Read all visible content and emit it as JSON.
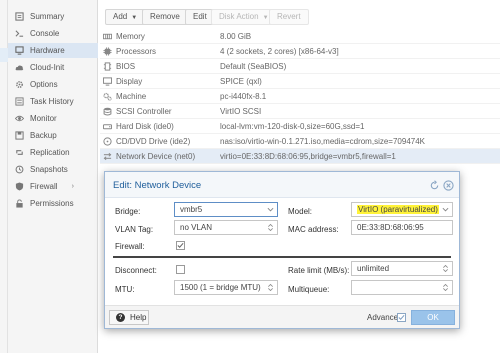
{
  "sidebar": {
    "items": [
      {
        "label": "Summary",
        "icon": "summary-icon"
      },
      {
        "label": "Console",
        "icon": "console-icon"
      },
      {
        "label": "Hardware",
        "icon": "desktop-icon",
        "active": true
      },
      {
        "label": "Cloud-Init",
        "icon": "cloud-icon"
      },
      {
        "label": "Options",
        "icon": "gear-icon"
      },
      {
        "label": "Task History",
        "icon": "list-icon"
      },
      {
        "label": "Monitor",
        "icon": "eye-icon"
      },
      {
        "label": "Backup",
        "icon": "floppy-icon"
      },
      {
        "label": "Replication",
        "icon": "retweet-icon"
      },
      {
        "label": "Snapshots",
        "icon": "history-icon"
      },
      {
        "label": "Firewall",
        "icon": "shield-icon"
      },
      {
        "label": "Permissions",
        "icon": "unlock-icon"
      }
    ]
  },
  "toolbar": {
    "add": "Add",
    "remove": "Remove",
    "edit": "Edit",
    "disk_action": "Disk Action",
    "revert": "Revert"
  },
  "hardware": [
    {
      "key": "Memory",
      "value": "8.00 GiB",
      "icon": "memory-icon"
    },
    {
      "key": "Processors",
      "value": "4 (2 sockets, 2 cores) [x86-64-v3]",
      "icon": "cpu-icon"
    },
    {
      "key": "BIOS",
      "value": "Default (SeaBIOS)",
      "icon": "microchip-icon"
    },
    {
      "key": "Display",
      "value": "SPICE (qxl)",
      "icon": "monitor-icon"
    },
    {
      "key": "Machine",
      "value": "pc-i440fx-8.1",
      "icon": "cogs-icon"
    },
    {
      "key": "SCSI Controller",
      "value": "VirtIO SCSI",
      "icon": "database-icon"
    },
    {
      "key": "Hard Disk (ide0)",
      "value": "local-lvm:vm-120-disk-0,size=60G,ssd=1",
      "icon": "hdd-icon"
    },
    {
      "key": "CD/DVD Drive (ide2)",
      "value": "nas:iso/virtio-win-0.1.271.iso,media=cdrom,size=709474K",
      "icon": "cdrom-icon"
    },
    {
      "key": "Network Device (net0)",
      "value": "virtio=0E:33:8D:68:06:95,bridge=vmbr5,firewall=1",
      "icon": "exchange-icon",
      "selected": true
    }
  ],
  "dialog": {
    "title": "Edit: Network Device",
    "bridge_label": "Bridge:",
    "bridge_value": "vmbr5",
    "vlan_label": "VLAN Tag:",
    "vlan_value": "no VLAN",
    "firewall_label": "Firewall:",
    "firewall_checked": true,
    "model_label": "Model:",
    "model_value": "VirtIO (paravirtualized)",
    "mac_label": "MAC address:",
    "mac_value": "0E:33:8D:68:06:95",
    "disconnect_label": "Disconnect:",
    "disconnect_checked": false,
    "mtu_label": "MTU:",
    "mtu_value": "1500 (1 = bridge MTU)",
    "rate_label": "Rate limit (MB/s):",
    "rate_value": "unlimited",
    "multiqueue_label": "Multiqueue:",
    "multiqueue_value": "",
    "help_label": "Help",
    "advanced_label": "Advanced",
    "advanced_checked": true,
    "ok_label": "OK"
  },
  "colors": {
    "title_blue": "#1f5e9b",
    "selected_row": "#e4ecf6",
    "highlight": "#fff33a",
    "ok_button": "#9ac3ea"
  }
}
